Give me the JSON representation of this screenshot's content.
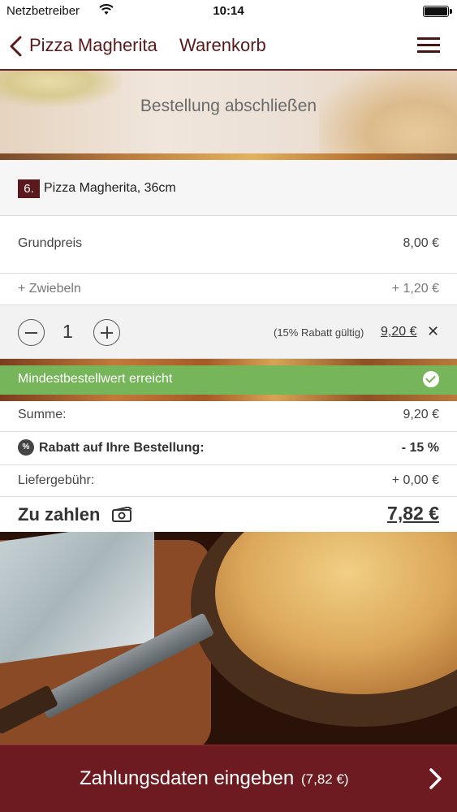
{
  "status_bar": {
    "carrier": "Netzbetreiber",
    "time": "10:14"
  },
  "nav": {
    "back_label": "Pizza Magherita",
    "title": "Warenkorb"
  },
  "hero": {
    "title": "Bestellung abschließen"
  },
  "item": {
    "number": "6.",
    "name": "Pizza Magherita, 36cm"
  },
  "lines": {
    "base_label": "Grundpreis",
    "base_price": "8,00 €",
    "topping_label": "+ Zwiebeln",
    "topping_price": "+ 1,20 €"
  },
  "quantity": {
    "value": "1",
    "discount_note": "(15% Rabatt gültig)",
    "line_price": "9,20 €",
    "remove_symbol": "✕"
  },
  "min_order": {
    "label": "Mindestbestellwert erreicht"
  },
  "summary": {
    "sum_label": "Summe:",
    "sum_value": "9,20 €",
    "discount_icon_text": "%",
    "discount_label": "Rabatt auf Ihre Bestellung:",
    "discount_value": "- 15 %",
    "fee_label": "Liefergebühr:",
    "fee_value": "+ 0,00 €",
    "total_label": "Zu zahlen",
    "total_value": "7,82 €"
  },
  "cta": {
    "label": "Zahlungsdaten eingeben",
    "amount": "(7,82 €)"
  },
  "colors": {
    "brand": "#6d1a20",
    "success": "#77b55a"
  },
  "icons": [
    "chevron-left-icon",
    "menu-icon",
    "minus-icon",
    "plus-icon",
    "close-icon",
    "check-icon",
    "percent-icon",
    "cash-icon",
    "chevron-right-icon",
    "wifi-icon",
    "battery-icon"
  ]
}
